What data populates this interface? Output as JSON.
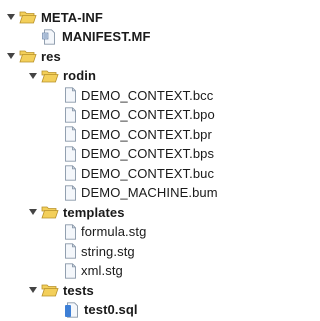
{
  "tree": [
    {
      "label": "META-INF",
      "depth": 0,
      "kind": "folder",
      "expanded": true,
      "bold": true,
      "icon": "folder-open-icon"
    },
    {
      "label": "MANIFEST.MF",
      "depth": 1,
      "kind": "file",
      "bold": true,
      "icon": "manifest-file-icon"
    },
    {
      "label": "res",
      "depth": 0,
      "kind": "folder",
      "expanded": true,
      "bold": true,
      "icon": "folder-open-icon"
    },
    {
      "label": "rodin",
      "depth": 1,
      "kind": "folder",
      "expanded": true,
      "bold": true,
      "icon": "folder-open-icon"
    },
    {
      "label": "DEMO_CONTEXT.bcc",
      "depth": 2,
      "kind": "file",
      "bold": false,
      "icon": "file-icon"
    },
    {
      "label": "DEMO_CONTEXT.bpo",
      "depth": 2,
      "kind": "file",
      "bold": false,
      "icon": "file-icon"
    },
    {
      "label": "DEMO_CONTEXT.bpr",
      "depth": 2,
      "kind": "file",
      "bold": false,
      "icon": "file-icon"
    },
    {
      "label": "DEMO_CONTEXT.bps",
      "depth": 2,
      "kind": "file",
      "bold": false,
      "icon": "file-icon"
    },
    {
      "label": "DEMO_CONTEXT.buc",
      "depth": 2,
      "kind": "file",
      "bold": false,
      "icon": "file-icon"
    },
    {
      "label": "DEMO_MACHINE.bum",
      "depth": 2,
      "kind": "file",
      "bold": false,
      "icon": "file-icon"
    },
    {
      "label": "templates",
      "depth": 1,
      "kind": "folder",
      "expanded": true,
      "bold": true,
      "icon": "folder-open-icon"
    },
    {
      "label": "formula.stg",
      "depth": 2,
      "kind": "file",
      "bold": false,
      "icon": "file-icon"
    },
    {
      "label": "string.stg",
      "depth": 2,
      "kind": "file",
      "bold": false,
      "icon": "file-icon"
    },
    {
      "label": "xml.stg",
      "depth": 2,
      "kind": "file",
      "bold": false,
      "icon": "file-icon"
    },
    {
      "label": "tests",
      "depth": 1,
      "kind": "folder",
      "expanded": true,
      "bold": true,
      "icon": "folder-open-icon"
    },
    {
      "label": "test0.sql",
      "depth": 2,
      "kind": "file",
      "bold": true,
      "icon": "sql-file-icon"
    }
  ],
  "colors": {
    "folder_fill": "#f3cf5a",
    "folder_stroke": "#b8912a",
    "file_fill": "#f4f7fb",
    "file_stroke": "#8796a8",
    "sql_accent": "#3d7fd6",
    "arrow": "#444444"
  }
}
